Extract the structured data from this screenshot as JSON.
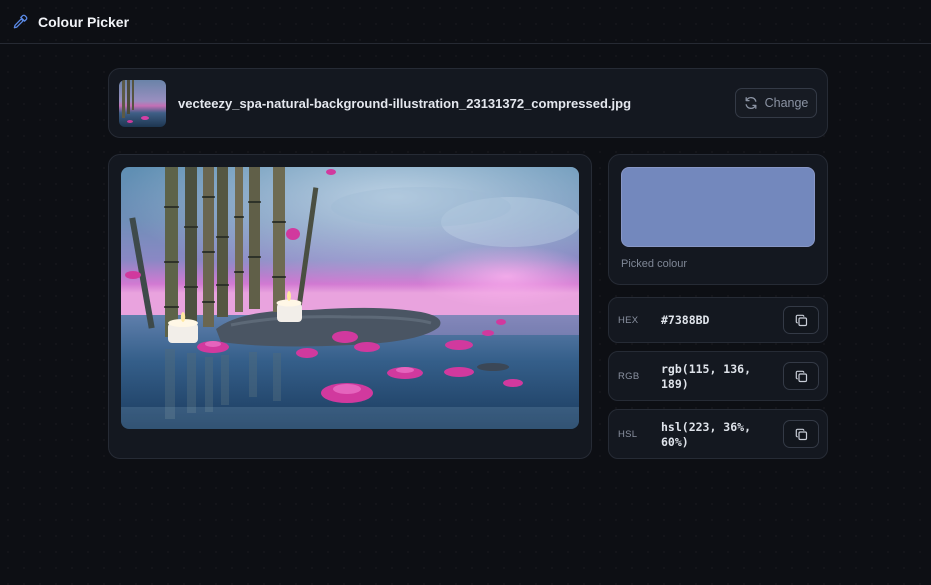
{
  "app": {
    "title": "Colour Picker",
    "icon": "eyedropper-icon",
    "accent": "#4f7fd8"
  },
  "file": {
    "name": "vecteezy_spa-natural-background-illustration_23131372_compressed.jpg",
    "thumbnail_icon": "image-thumbnail"
  },
  "actions": {
    "change_label": "Change",
    "change_icon": "refresh-icon"
  },
  "picked": {
    "color": "#7388BD",
    "label": "Picked colour"
  },
  "values": {
    "hex": {
      "label": "HEX",
      "value": "#7388BD"
    },
    "rgb": {
      "label": "RGB",
      "value": "rgb(115, 136, 189)"
    },
    "hsl": {
      "label": "HSL",
      "value": "hsl(223, 36%, 60%)"
    }
  },
  "copy_icon": "copy-icon"
}
